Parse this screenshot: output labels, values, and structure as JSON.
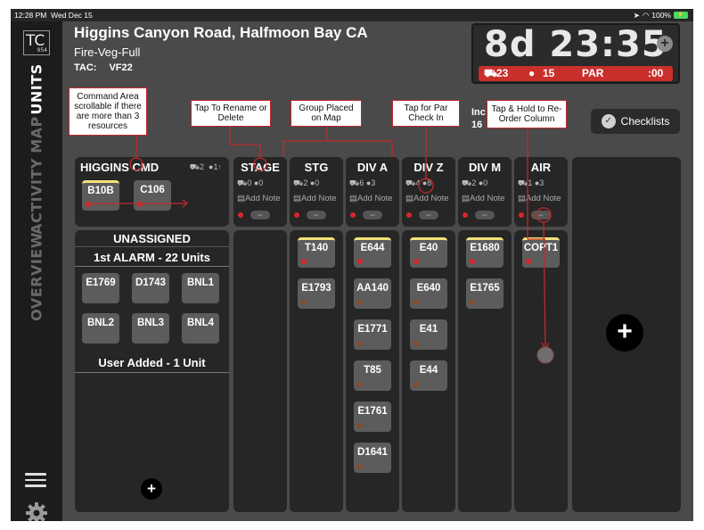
{
  "status_bar": {
    "time": "12:28 PM",
    "date": "Wed Dec 15",
    "battery": "100%"
  },
  "sidebar": {
    "logo": "TC",
    "logo_sub": "954",
    "tabs": [
      "UNITS",
      "MAP",
      "ACTIVITY",
      "OVERVIEW"
    ],
    "active_tab": "UNITS"
  },
  "header": {
    "title": "Higgins Canyon Road, Halfmoon Bay CA",
    "incident_type": "Fire-Veg-Full",
    "tac_label": "TAC:",
    "tac_value": "VF22",
    "timer": "8d 23:35",
    "par_trucks": "23",
    "par_people": "15",
    "par_label": "PAR",
    "par_time": ":00",
    "inc_label": "Inc",
    "inc_value": "16",
    "checklists_label": "Checklists"
  },
  "command": {
    "title": "HIGGINS CMD",
    "truck_count": "2",
    "person_count": "1",
    "units": [
      "B10B",
      "C106"
    ]
  },
  "columns": [
    {
      "title": "STAGE",
      "trucks": "0",
      "people": "0",
      "note": "Add Note",
      "units": []
    },
    {
      "title": "STG",
      "trucks": "2",
      "people": "0",
      "note": "Add Note",
      "units": [
        "T140",
        "E1793"
      ]
    },
    {
      "title": "DIV A",
      "trucks": "6",
      "people": "3",
      "note": "Add Note",
      "units": [
        "E644",
        "AA140",
        "E1771",
        "T85",
        "E1761",
        "D1641"
      ]
    },
    {
      "title": "DIV Z",
      "trucks": "4",
      "people": "8",
      "note": "Add Note",
      "units": [
        "E40",
        "E640",
        "E41",
        "E44"
      ]
    },
    {
      "title": "DIV M",
      "trucks": "2",
      "people": "0",
      "note": "Add Note",
      "units": [
        "E1680",
        "E1765"
      ]
    },
    {
      "title": "AIR",
      "trucks": "1",
      "people": "3",
      "note": "Add Note",
      "units": [
        "COPT1"
      ]
    }
  ],
  "unassigned": {
    "title": "UNASSIGNED",
    "alarm_label": "1st ALARM - 22 Units",
    "alarm_units": [
      "E1769",
      "D1743",
      "BNL1",
      "BNL2",
      "BNL3",
      "BNL4"
    ],
    "user_added_label": "User Added - 1 Unit"
  },
  "callouts": {
    "command_area": "Command Area scrollable if there are more than 3 resources",
    "rename": "Tap To Rename or Delete",
    "group_placed": "Group Placed on Map",
    "par_check": "Tap for Par Check In",
    "reorder": "Tap & Hold to Re-Order Column"
  },
  "colors": {
    "accent_red": "#c0292b",
    "par_bar": "#c9302c",
    "unit_highlight": "#f2e37a"
  }
}
